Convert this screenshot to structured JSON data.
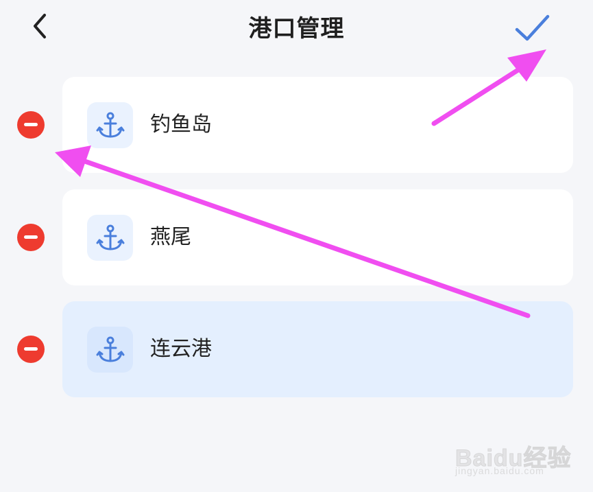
{
  "header": {
    "title": "港口管理",
    "back_icon": "chevron-left-icon",
    "confirm_icon": "checkmark-icon"
  },
  "ports": [
    {
      "name": "钓鱼岛",
      "icon": "anchor-icon",
      "selected": false
    },
    {
      "name": "燕尾",
      "icon": "anchor-icon",
      "selected": false
    },
    {
      "name": "连云港",
      "icon": "anchor-icon",
      "selected": true
    }
  ],
  "watermark": {
    "brand": "Baidu经验",
    "url": "jingyan.baidu.com"
  },
  "colors": {
    "background": "#f5f6f9",
    "card": "#ffffff",
    "card_selected": "#e4effe",
    "remove": "#ee3b2f",
    "accent": "#4a7fdc",
    "annotation_arrow": "#f04ef0"
  }
}
